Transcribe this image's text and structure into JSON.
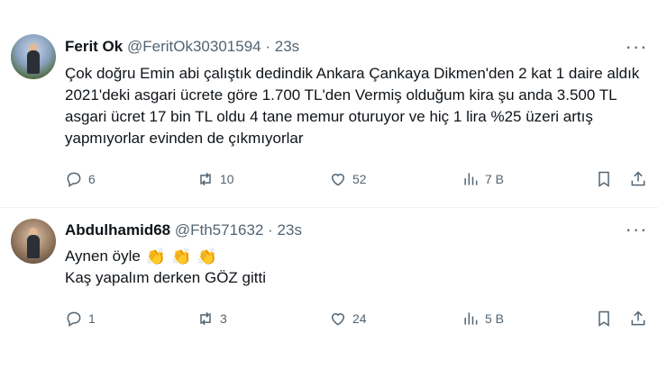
{
  "tweets": [
    {
      "name": "Ferit Ok",
      "handle": "@FeritOk30301594",
      "separator": "·",
      "time": "23s",
      "text": "Çok doğru Emin abi çalıştık dedindik Ankara Çankaya Dikmen'den 2 kat 1 daire aldık 2021'deki asgari ücrete göre 1.700 TL'den Vermiş olduğum kira şu anda 3.500 TL asgari ücret 17 bin TL  oldu 4 tane memur oturuyor ve hiç 1 lira %25 üzeri artış yapmıyorlar evinden de çıkmıyorlar",
      "replies": "6",
      "retweets": "10",
      "likes": "52",
      "views": "7 B",
      "more": "···"
    },
    {
      "name": "Abdulhamid68",
      "handle": "@Fth571632",
      "separator": "·",
      "time": "23s",
      "line1": "Aynen öyle",
      "clap": "👏",
      "line2": "Kaş yapalım derken GÖZ gitti",
      "replies": "1",
      "retweets": "3",
      "likes": "24",
      "views": "5 B",
      "more": "···"
    }
  ],
  "icons": {
    "reply": "reply-icon",
    "retweet": "retweet-icon",
    "like": "heart-icon",
    "views": "views-icon",
    "bookmark": "bookmark-icon",
    "share": "share-icon",
    "more": "more-icon"
  },
  "colors": {
    "text": "#0f1419",
    "secondary": "#536471",
    "divider": "#eff3f4"
  }
}
